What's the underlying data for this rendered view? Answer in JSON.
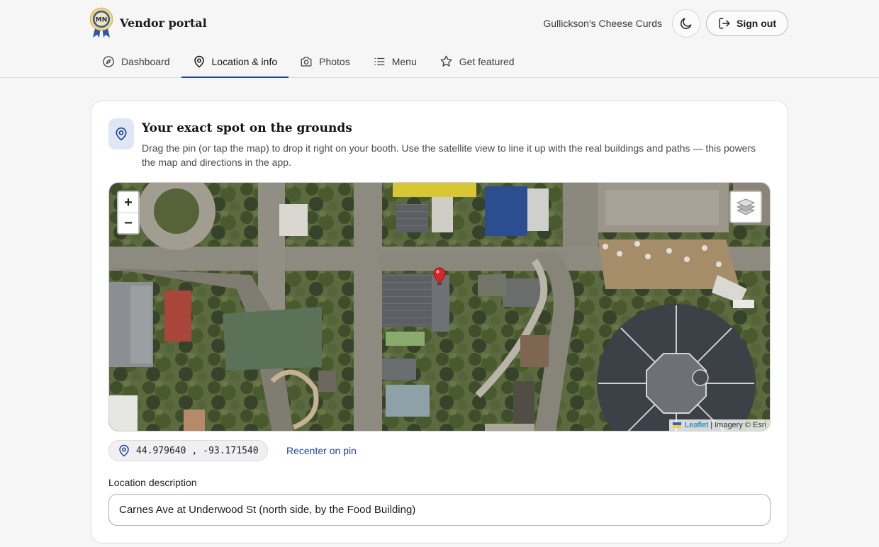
{
  "brand": {
    "title": "Vendor portal",
    "logo_text": "MN"
  },
  "header": {
    "vendor_name": "Gullickson's Cheese Curds",
    "theme_icon": "moon-icon",
    "sign_out_label": "Sign out"
  },
  "tabs": [
    {
      "label": "Dashboard",
      "icon": "compass-icon",
      "active": false
    },
    {
      "label": "Location & info",
      "icon": "map-pin-icon",
      "active": true
    },
    {
      "label": "Photos",
      "icon": "camera-icon",
      "active": false
    },
    {
      "label": "Menu",
      "icon": "list-icon",
      "active": false
    },
    {
      "label": "Get featured",
      "icon": "star-icon",
      "active": false
    }
  ],
  "card": {
    "title": "Your exact spot on the grounds",
    "description": "Drag the pin (or tap the map) to drop it right on your booth. Use the satellite view to line it up with the real buildings and paths — this powers the map and directions in the app."
  },
  "map": {
    "zoom_in": "+",
    "zoom_out": "−",
    "attribution_link": "Leaflet",
    "attribution_rest": "| Imagery © Esri"
  },
  "coordinates": {
    "lat": "44.979640",
    "separator": ",",
    "lng": "-93.171540",
    "recenter_label": "Recenter on pin"
  },
  "location_description": {
    "label": "Location description",
    "value": "Carnes Ave at Underwood St (north side, by the Food Building)"
  },
  "colors": {
    "accent": "#1e4496",
    "pin": "#d9262b",
    "card_bg": "#ffffff",
    "page_bg": "#f6f6f7"
  }
}
